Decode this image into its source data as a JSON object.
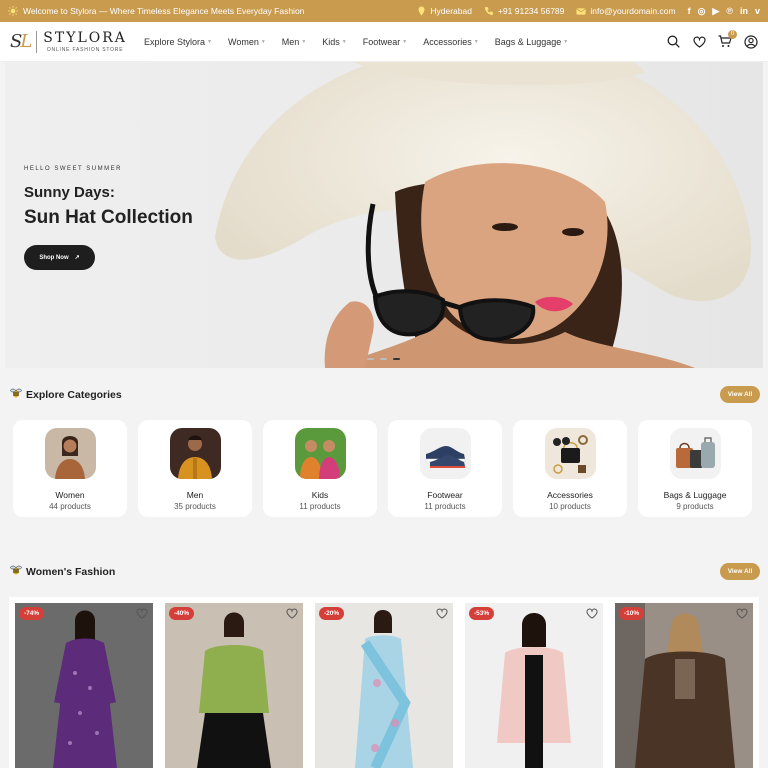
{
  "topbar": {
    "welcome": "Welcome to Stylora — Where Timeless Elegance Meets Everyday Fashion",
    "location": "Hyderabad",
    "phone": "+91 91234 56789",
    "email": "info@yourdomain.com",
    "socials": [
      {
        "icon": "facebook-icon",
        "glyph": "f"
      },
      {
        "icon": "instagram-icon",
        "glyph": "◎"
      },
      {
        "icon": "youtube-icon",
        "glyph": "▶"
      },
      {
        "icon": "pinterest-icon",
        "glyph": "℗"
      },
      {
        "icon": "linkedin-icon",
        "glyph": "in"
      },
      {
        "icon": "vimeo-icon",
        "glyph": "v"
      }
    ]
  },
  "brand": {
    "mark_left": "S",
    "mark_right": "L",
    "name": "STYLORA",
    "tagline": "ONLINE FASHION STORE"
  },
  "nav": {
    "items": [
      "Explore Stylora",
      "Women",
      "Men",
      "Kids",
      "Footwear",
      "Accessories",
      "Bags & Luggage"
    ]
  },
  "header": {
    "cart_count": "0",
    "icons": [
      "search-icon",
      "heart-icon",
      "cart-icon",
      "user-icon"
    ]
  },
  "hero": {
    "eyebrow": "HELLO SWEET SUMMER",
    "title_line1": "Sunny Days:",
    "title_line2": "Sun Hat Collection",
    "cta": "Shop Now",
    "cta_icon": "↗",
    "slides_total": 3,
    "active_slide": 3
  },
  "categories": {
    "title": "Explore Categories",
    "view_all": "View All",
    "items": [
      {
        "name": "Women",
        "count": "44 products"
      },
      {
        "name": "Men",
        "count": "35 products"
      },
      {
        "name": "Kids",
        "count": "11 products"
      },
      {
        "name": "Footwear",
        "count": "11 products"
      },
      {
        "name": "Accessories",
        "count": "10 products"
      },
      {
        "name": "Bags & Luggage",
        "count": "9 products"
      }
    ]
  },
  "womens": {
    "title": "Women's Fashion",
    "view_all": "View All",
    "products": [
      {
        "discount": "-74%"
      },
      {
        "discount": "-40%"
      },
      {
        "discount": "-20%"
      },
      {
        "discount": "-53%"
      },
      {
        "discount": "-10%"
      }
    ]
  },
  "colors": {
    "accent": "#c89b4f",
    "badge_red": "#d43f3a",
    "dark": "#1e1e1e"
  }
}
